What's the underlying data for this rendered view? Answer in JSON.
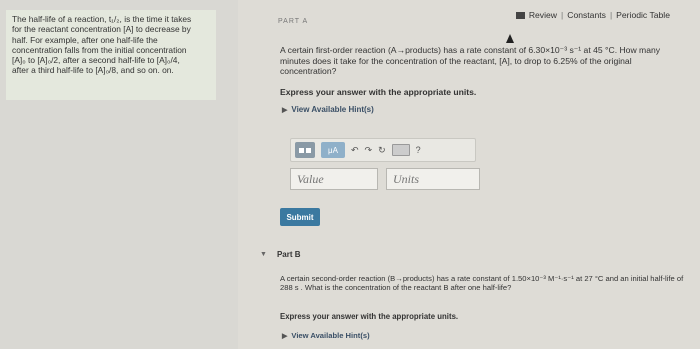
{
  "sidebar": {
    "lines": [
      "The half-life of a reaction, t₁/₂, is the time it takes",
      "for the reactant concentration [A] to decrease by",
      "half. For example, after one half-life the",
      "concentration falls from the initial concentration",
      "[A]₀ to [A]₀/2, after a second half-life to [A]₀/4,",
      "after a third half-life to [A]₀/8, and so on. on."
    ]
  },
  "topbar": {
    "review": "Review",
    "sep1": "|",
    "constants": "Constants",
    "sep2": "|",
    "periodic": "Periodic Table"
  },
  "part_a": {
    "header": "PART A",
    "question": "A certain first-order reaction (A→products) has a rate constant of 6.30×10⁻³ s⁻¹ at 45 °C. How many minutes does it take for the concentration of the reactant, [A], to drop to 6.25% of the original concentration?",
    "instructions": "Express your answer with the appropriate units.",
    "hints": "View Available Hint(s)",
    "value_placeholder": "Value",
    "units_placeholder": "Units",
    "submit": "Submit",
    "toolbar": {
      "mu": "μA",
      "undo": "↶",
      "redo": "↷",
      "reset": "↻",
      "help": "?"
    }
  },
  "part_b": {
    "label": "Part B",
    "question": "A certain second-order reaction (B→products) has a rate constant of 1.50×10⁻³ M⁻¹·s⁻¹ at 27 °C and an initial half-life of 288 s . What is the concentration of the reactant B after one half-life?",
    "instructions": "Express your answer with the appropriate units.",
    "hints": "View Available Hint(s)"
  }
}
